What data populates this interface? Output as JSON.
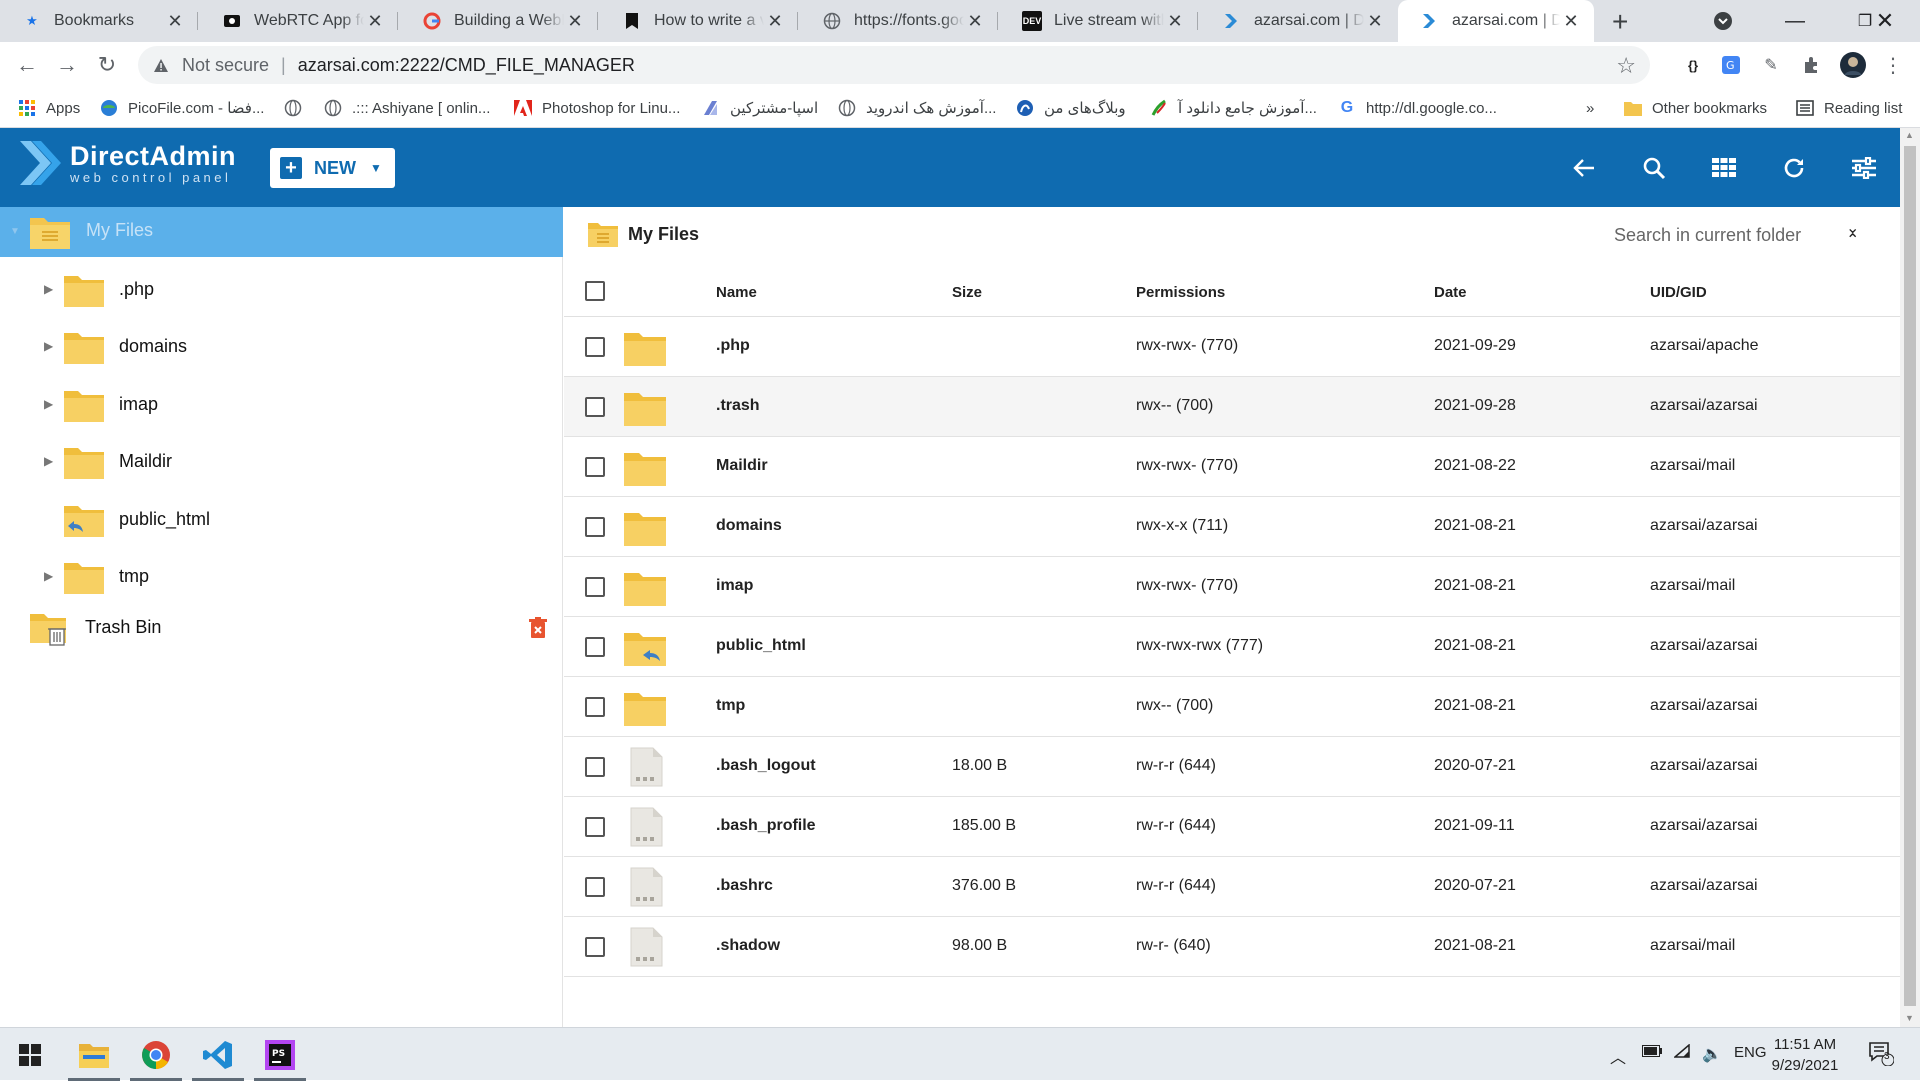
{
  "browser": {
    "tabs": [
      {
        "title": "Bookmarks",
        "icon": "star-icon"
      },
      {
        "title": "WebRTC App for Electron",
        "icon": "video-icon"
      },
      {
        "title": "Building a WebRTC",
        "icon": "google-icon"
      },
      {
        "title": "How to write a video",
        "icon": "bookmark-icon"
      },
      {
        "title": "https://fonts.google",
        "icon": "globe-icon"
      },
      {
        "title": "Live stream with Vue",
        "icon": "dev-icon"
      },
      {
        "title": "azarsai.com | Dashboard",
        "icon": "directadmin-icon"
      },
      {
        "title": "azarsai.com | DirectAdmin",
        "icon": "directadmin-icon",
        "active": true
      }
    ],
    "address": {
      "security": "Not secure",
      "url": "azarsai.com:2222/CMD_FILE_MANAGER"
    },
    "bookmarks": [
      {
        "label": "Apps",
        "icon": "apps-grid-icon"
      },
      {
        "label": "PicoFile.com - فضا...",
        "icon": "picofile-icon"
      },
      {
        "label": "",
        "icon": "globe-icon"
      },
      {
        "label": ".::: Ashiyane [ onlin...",
        "icon": "globe-icon"
      },
      {
        "label": "Photoshop for Linu...",
        "icon": "adobe-icon"
      },
      {
        "label": "اسپا-مشترکین",
        "icon": "aspa-icon"
      },
      {
        "label": "آموزش هک اندروید...",
        "icon": "globe-icon"
      },
      {
        "label": "وبلاگ‌های من",
        "icon": "blog-icon"
      },
      {
        "label": "آموزش جامع دانلود آ...",
        "icon": "flag-icon"
      },
      {
        "label": "http://dl.google.co...",
        "icon": "google-icon"
      }
    ],
    "more_bookmarks": "»",
    "other_bookmarks": "Other bookmarks",
    "reading_list": "Reading list"
  },
  "header": {
    "logo_title": "DirectAdmin",
    "logo_subtitle": "web control panel",
    "new_button": "NEW",
    "brand_color": "#0f6bb0"
  },
  "sidebar": {
    "root": "My Files",
    "items": [
      {
        "label": ".php",
        "expandable": true
      },
      {
        "label": "domains",
        "expandable": true
      },
      {
        "label": "imap",
        "expandable": true
      },
      {
        "label": "Maildir",
        "expandable": true
      },
      {
        "label": "public_html",
        "expandable": false,
        "linked": true
      },
      {
        "label": "tmp",
        "expandable": true
      }
    ],
    "trash": "Trash Bin"
  },
  "main": {
    "folder_title": "My Files",
    "search_placeholder": "Search in current folder",
    "columns": {
      "name": "Name",
      "size": "Size",
      "permissions": "Permissions",
      "date": "Date",
      "owner": "UID/GID"
    },
    "rows": [
      {
        "name": ".php",
        "type": "folder",
        "size": "",
        "permissions": "rwx-rwx- (770)",
        "date": "2021-09-29",
        "owner": "azarsai/apache"
      },
      {
        "name": ".trash",
        "type": "folder",
        "size": "",
        "permissions": "rwx-- (700)",
        "date": "2021-09-28",
        "owner": "azarsai/azarsai"
      },
      {
        "name": "Maildir",
        "type": "folder",
        "size": "",
        "permissions": "rwx-rwx- (770)",
        "date": "2021-08-22",
        "owner": "azarsai/mail"
      },
      {
        "name": "domains",
        "type": "folder",
        "size": "",
        "permissions": "rwx-x-x (711)",
        "date": "2021-08-21",
        "owner": "azarsai/azarsai"
      },
      {
        "name": "imap",
        "type": "folder",
        "size": "",
        "permissions": "rwx-rwx- (770)",
        "date": "2021-08-21",
        "owner": "azarsai/mail"
      },
      {
        "name": "public_html",
        "type": "link-folder",
        "size": "",
        "permissions": "rwx-rwx-rwx (777)",
        "date": "2021-08-21",
        "owner": "azarsai/azarsai"
      },
      {
        "name": "tmp",
        "type": "folder",
        "size": "",
        "permissions": "rwx-- (700)",
        "date": "2021-08-21",
        "owner": "azarsai/azarsai"
      },
      {
        "name": ".bash_logout",
        "type": "file",
        "size": "18.00 B",
        "permissions": "rw-r-r (644)",
        "date": "2020-07-21",
        "owner": "azarsai/azarsai"
      },
      {
        "name": ".bash_profile",
        "type": "file",
        "size": "185.00 B",
        "permissions": "rw-r-r (644)",
        "date": "2021-09-11",
        "owner": "azarsai/azarsai"
      },
      {
        "name": ".bashrc",
        "type": "file",
        "size": "376.00 B",
        "permissions": "rw-r-r (644)",
        "date": "2020-07-21",
        "owner": "azarsai/azarsai"
      },
      {
        "name": ".shadow",
        "type": "file",
        "size": "98.00 B",
        "permissions": "rw-r- (640)",
        "date": "2021-08-21",
        "owner": "azarsai/mail"
      }
    ]
  },
  "taskbar": {
    "apps": [
      "file-explorer-icon",
      "chrome-icon",
      "vscode-icon",
      "phpstorm-icon"
    ],
    "language": "ENG",
    "time": "11:51 AM",
    "date": "9/29/2021",
    "notification_count": "3"
  }
}
